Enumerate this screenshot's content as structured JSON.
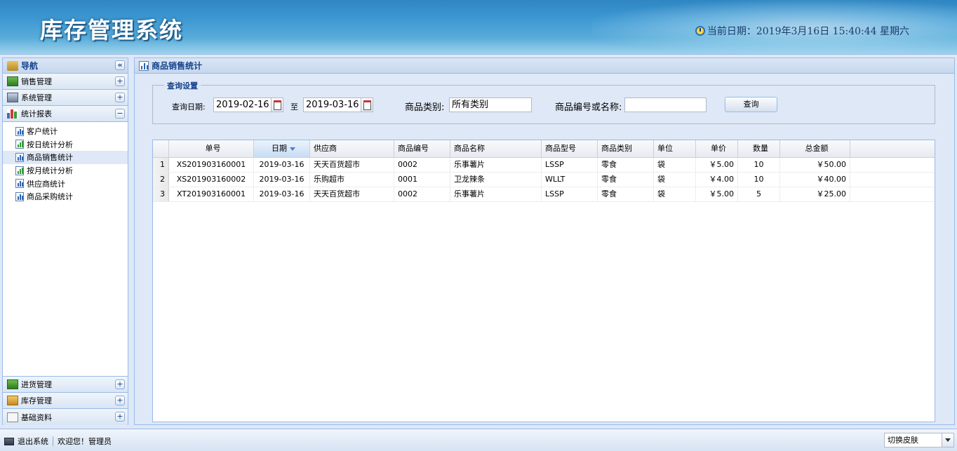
{
  "header": {
    "title": "库存管理系统",
    "date_text": "当前日期：2019年3月16日  15:40:44 星期六"
  },
  "nav": {
    "title": "导航",
    "top_sections": [
      {
        "label": "销售管理",
        "toggle": "+"
      },
      {
        "label": "系统管理",
        "toggle": "+"
      },
      {
        "label": "统计报表",
        "toggle": "−"
      }
    ],
    "tree_items": [
      {
        "label": "客户统计"
      },
      {
        "label": "按日统计分析"
      },
      {
        "label": "商品销售统计"
      },
      {
        "label": "按月统计分析"
      },
      {
        "label": "供应商统计"
      },
      {
        "label": "商品采购统计"
      }
    ],
    "bottom_sections": [
      {
        "label": "进货管理",
        "toggle": "+"
      },
      {
        "label": "库存管理",
        "toggle": "+"
      },
      {
        "label": "基础资料",
        "toggle": "+"
      }
    ],
    "collapse_glyph": "«"
  },
  "main": {
    "title": "商品销售统计",
    "query": {
      "legend": "查询设置",
      "date_label": "查询日期:",
      "start_date": "2019-02-16",
      "to_label": "至",
      "end_date": "2019-03-16",
      "category_label": "商品类别:",
      "category_value": "所有类别",
      "code_label": "商品编号或名称:",
      "code_value": "",
      "search_button": "查询"
    },
    "grid": {
      "columns": [
        "单号",
        "日期",
        "供应商",
        "商品编号",
        "商品名称",
        "商品型号",
        "商品类别",
        "单位",
        "单价",
        "数量",
        "总金额"
      ],
      "rows": [
        {
          "n": "1",
          "order": "XS201903160001",
          "date": "2019-03-16",
          "supplier": "天天百货超市",
          "code": "0002",
          "name": "乐事薯片",
          "model": "LSSP",
          "category": "零食",
          "unit": "袋",
          "price": "￥5.00",
          "qty": "10",
          "total": "￥50.00"
        },
        {
          "n": "2",
          "order": "XS201903160002",
          "date": "2019-03-16",
          "supplier": "乐购超市",
          "code": "0001",
          "name": "卫龙辣条",
          "model": "WLLT",
          "category": "零食",
          "unit": "袋",
          "price": "￥4.00",
          "qty": "10",
          "total": "￥40.00"
        },
        {
          "n": "3",
          "order": "XT201903160001",
          "date": "2019-03-16",
          "supplier": "天天百货超市",
          "code": "0002",
          "name": "乐事薯片",
          "model": "LSSP",
          "category": "零食",
          "unit": "袋",
          "price": "￥5.00",
          "qty": "5",
          "total": "￥25.00"
        }
      ]
    }
  },
  "footer": {
    "exit_label": "退出系统",
    "welcome": "欢迎您！管理员",
    "skin_label": "切换皮肤"
  }
}
